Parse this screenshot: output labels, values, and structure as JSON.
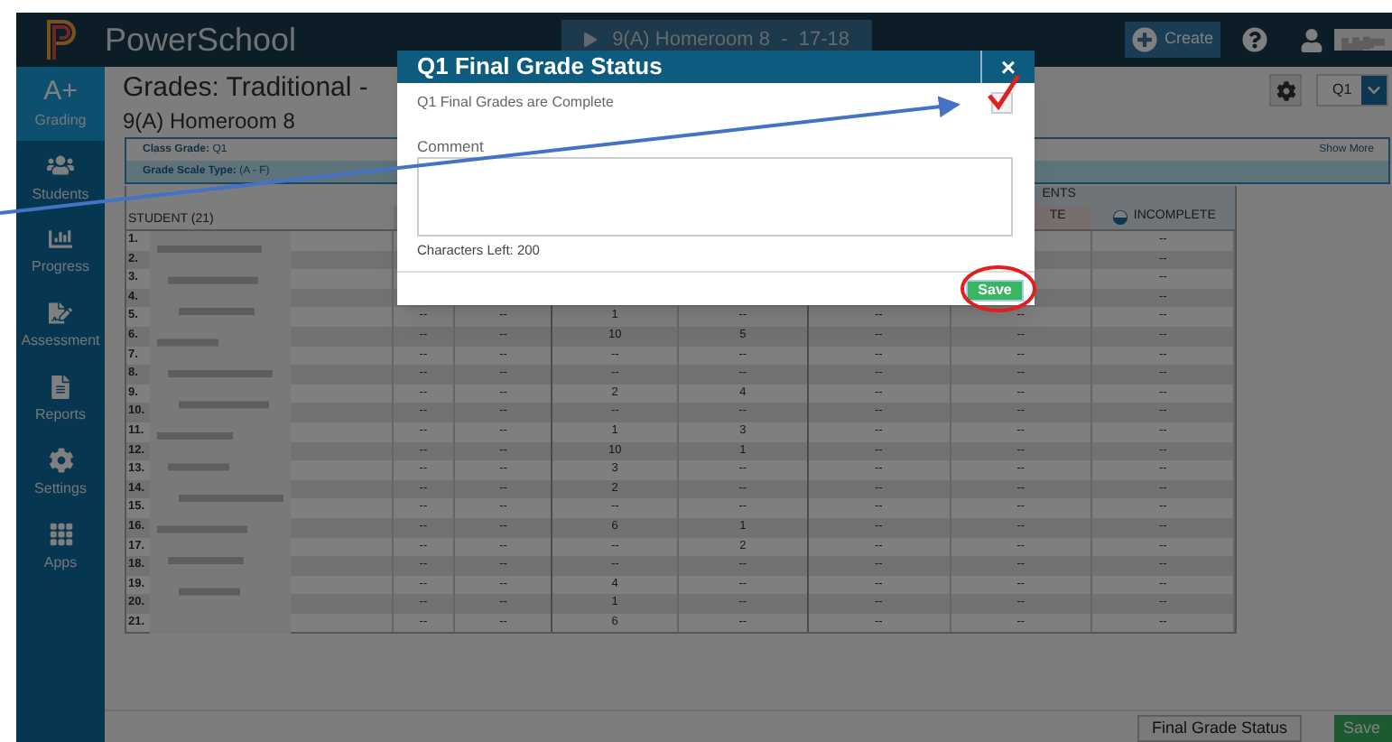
{
  "top_bar": {
    "brand": "PowerSchool",
    "section": "9(A) Homeroom 8  -  17-18",
    "create": "Create"
  },
  "sidebar": {
    "items": [
      {
        "label": "Grading",
        "kind": "grading",
        "glyph": "A+",
        "selected": true
      },
      {
        "label": "Students",
        "kind": "students",
        "selected": false
      },
      {
        "label": "Progress",
        "kind": "progress",
        "selected": false
      },
      {
        "label": "Assessment",
        "kind": "assessment",
        "selected": false
      },
      {
        "label": "Reports",
        "kind": "reports",
        "selected": false
      },
      {
        "label": "Settings",
        "kind": "settings",
        "selected": false
      },
      {
        "label": "Apps",
        "kind": "apps",
        "selected": false
      }
    ]
  },
  "page": {
    "title": "Grades: Traditional -",
    "subtitle": "9(A) Homeroom 8",
    "term": "Q1"
  },
  "info": {
    "class_grade_label": "Class Grade:",
    "class_grade": "Q1",
    "scale_label": "Grade Scale Type:",
    "scale": "(A - F)",
    "show_more": "Show More"
  },
  "table": {
    "student_header": "STUDENT (21)",
    "group_header": "ENTS",
    "late_header": "TE",
    "incomplete_header": "INCOMPLETE",
    "rows": [
      {
        "number": "1.",
        "cells": [
          null,
          null,
          null,
          null,
          null,
          null,
          "--"
        ]
      },
      {
        "number": "2.",
        "cells": [
          null,
          null,
          null,
          null,
          null,
          null,
          "--"
        ]
      },
      {
        "number": "3.",
        "cells": [
          null,
          null,
          null,
          null,
          null,
          null,
          "--"
        ]
      },
      {
        "number": "4.",
        "cells": [
          null,
          null,
          null,
          null,
          null,
          null,
          "--"
        ]
      },
      {
        "number": "5.",
        "cells": [
          "--",
          "--",
          "1",
          "--",
          "--",
          "--",
          "--"
        ]
      },
      {
        "number": "6.",
        "cells": [
          "--",
          "--",
          "10",
          "5",
          "--",
          "--",
          "--"
        ]
      },
      {
        "number": "7.",
        "cells": [
          "--",
          "--",
          "--",
          "--",
          "--",
          "--",
          "--"
        ]
      },
      {
        "number": "8.",
        "cells": [
          "--",
          "--",
          "--",
          "--",
          "--",
          "--",
          "--"
        ]
      },
      {
        "number": "9.",
        "cells": [
          "--",
          "--",
          "2",
          "4",
          "--",
          "--",
          "--"
        ]
      },
      {
        "number": "10.",
        "cells": [
          "--",
          "--",
          "--",
          "--",
          "--",
          "--",
          "--"
        ]
      },
      {
        "number": "11.",
        "cells": [
          "--",
          "--",
          "1",
          "3",
          "--",
          "--",
          "--"
        ]
      },
      {
        "number": "12.",
        "cells": [
          "--",
          "--",
          "10",
          "1",
          "--",
          "--",
          "--"
        ]
      },
      {
        "number": "13.",
        "cells": [
          "--",
          "--",
          "3",
          "--",
          "--",
          "--",
          "--"
        ]
      },
      {
        "number": "14.",
        "cells": [
          "--",
          "--",
          "2",
          "--",
          "--",
          "--",
          "--"
        ]
      },
      {
        "number": "15.",
        "cells": [
          "--",
          "--",
          "--",
          "--",
          "--",
          "--",
          "--"
        ]
      },
      {
        "number": "16.",
        "cells": [
          "--",
          "--",
          "6",
          "1",
          "--",
          "--",
          "--"
        ]
      },
      {
        "number": "17.",
        "cells": [
          "--",
          "--",
          "--",
          "2",
          "--",
          "--",
          "--"
        ]
      },
      {
        "number": "18.",
        "cells": [
          "--",
          "--",
          "--",
          "--",
          "--",
          "--",
          "--"
        ]
      },
      {
        "number": "19.",
        "cells": [
          "--",
          "--",
          "4",
          "--",
          "--",
          "--",
          "--"
        ]
      },
      {
        "number": "20.",
        "cells": [
          "--",
          "--",
          "1",
          "--",
          "--",
          "--",
          "--"
        ]
      },
      {
        "number": "21.",
        "cells": [
          "--",
          "--",
          "6",
          "--",
          "--",
          "--",
          "--"
        ]
      }
    ]
  },
  "footer": {
    "buttons": [
      {
        "label": "Final Grade Status",
        "kind": "default"
      },
      {
        "label": "Save",
        "kind": "primary"
      }
    ]
  },
  "modal": {
    "title": "Q1 Final Grade Status",
    "close": "×",
    "complete_label": "Q1 Final Grades are Complete",
    "checked": true,
    "comment_label": "Comment",
    "chars_left": "Characters Left: 200",
    "save": "Save"
  }
}
